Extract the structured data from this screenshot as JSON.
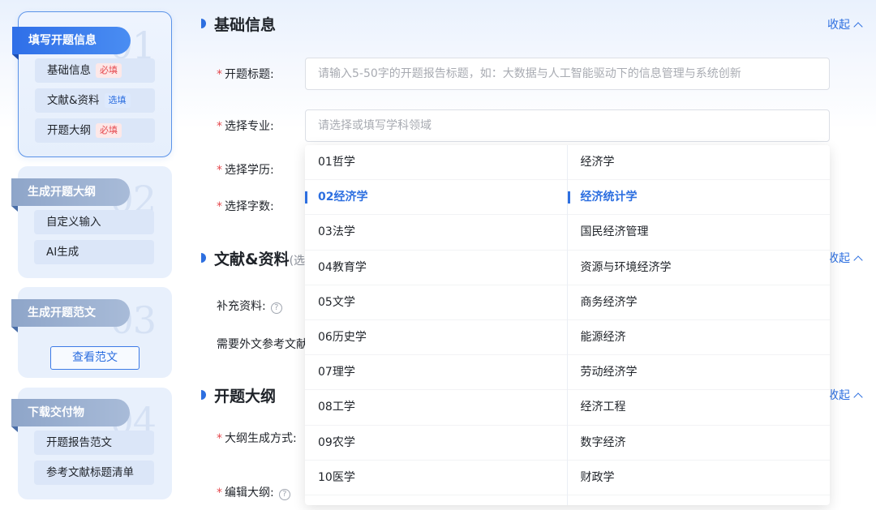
{
  "steps": [
    {
      "num": "01",
      "title": "填写开题信息",
      "items": [
        {
          "label": "基础信息",
          "tag": "必填"
        },
        {
          "label": "文献&资料",
          "tag": "选填"
        },
        {
          "label": "开题大纲",
          "tag": "必填"
        }
      ]
    },
    {
      "num": "02",
      "title": "生成开题大纲",
      "items": [
        {
          "label": "自定义输入"
        },
        {
          "label": "AI生成"
        }
      ]
    },
    {
      "num": "03",
      "title": "生成开题范文",
      "button": "查看范文"
    },
    {
      "num": "04",
      "title": "下载交付物",
      "items": [
        {
          "label": "开题报告范文"
        },
        {
          "label": "参考文献标题清单"
        }
      ]
    }
  ],
  "sections": {
    "basic": {
      "title": "基础信息",
      "collapse": "收起"
    },
    "literature": {
      "title": "文献&资料",
      "subtitle": "(选",
      "collapse": "收起"
    },
    "outline": {
      "title": "开题大纲",
      "collapse": "收起"
    }
  },
  "form": {
    "title_label": "开题标题:",
    "title_placeholder": "请输入5-50字的开题报告标题，如：大数据与人工智能驱动下的信息管理与系统创新",
    "major_label": "选择专业:",
    "major_placeholder": "请选择或填写学科领域",
    "degree_label": "选择学历:",
    "wordcount_label": "选择字数:",
    "supplement_label": "补充资料:",
    "foreign_ref_label": "需要外文参考文献",
    "outline_method_label": "大纲生成方式:",
    "edit_outline_label": "编辑大纲:",
    "required_mark": "*",
    "help_mark": "?"
  },
  "dropdown": {
    "disciplines": [
      "01哲学",
      "02经济学",
      "03法学",
      "04教育学",
      "05文学",
      "06历史学",
      "07理学",
      "08工学",
      "09农学",
      "10医学"
    ],
    "selected_discipline": "02经济学",
    "subjects": [
      "经济学",
      "经济统计学",
      "国民经济管理",
      "资源与环境经济学",
      "商务经济学",
      "能源经济",
      "劳动经济学",
      "经济工程",
      "数字经济",
      "财政学"
    ],
    "selected_subject": "经济统计学"
  },
  "colors": {
    "accent": "#2d6fe0",
    "required": "#e5484d"
  }
}
